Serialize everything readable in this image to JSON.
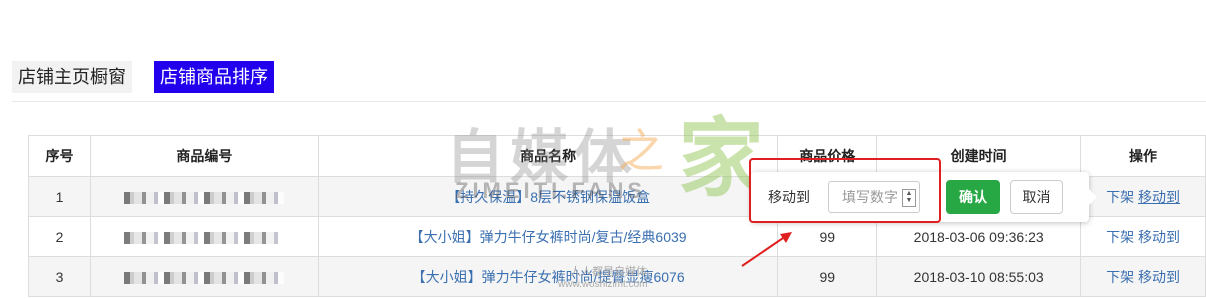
{
  "tabs": [
    {
      "label": "店铺主页橱窗",
      "active": false
    },
    {
      "label": "店铺商品排序",
      "active": true
    }
  ],
  "table": {
    "headers": [
      "序号",
      "商品编号",
      "商品名称",
      "商品价格",
      "创建时间",
      "操作"
    ],
    "rows": [
      {
        "index": "1",
        "name": "【持久保温】8层不锈钢保温饭盒",
        "price": "",
        "created": "",
        "op_remove": "下架",
        "op_move": "移动到"
      },
      {
        "index": "2",
        "name": "【大小姐】弹力牛仔女裤时尚/复古/经典6039",
        "price": "99",
        "created": "2018-03-06 09:36:23",
        "op_remove": "下架",
        "op_move": "移动到"
      },
      {
        "index": "3",
        "name": "【大小姐】弹力牛仔女裤时尚/提臀显瘦6076",
        "price": "99",
        "created": "2018-03-10 08:55:03",
        "op_remove": "下架",
        "op_move": "移动到"
      }
    ]
  },
  "popover": {
    "label": "移动到",
    "input_placeholder": "填写数字",
    "confirm_label": "确认",
    "cancel_label": "取消"
  },
  "watermark": {
    "main": "自媒体",
    "zhi": "之",
    "jia": "家",
    "english": "ZIMEITI.FANS",
    "small_line1": "人人都是自媒体",
    "small_line2": "www.woshizimt.com"
  },
  "colors": {
    "active_tab": "#2200ee",
    "confirm_button": "#28a745",
    "link": "#3a6fb0",
    "highlight": "#e02020"
  }
}
